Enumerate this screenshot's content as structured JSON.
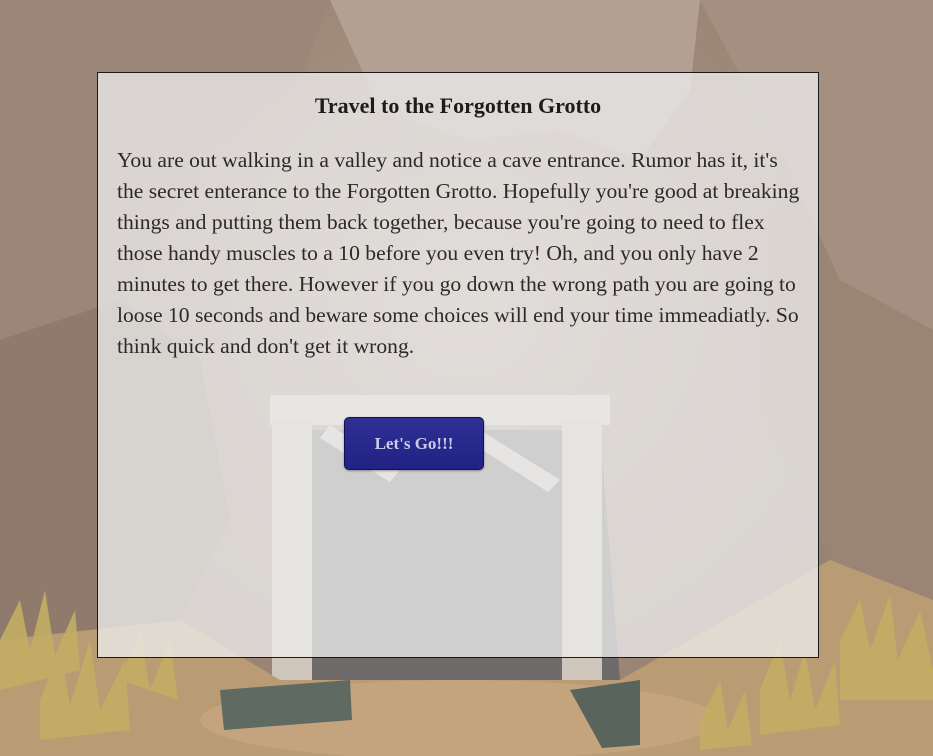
{
  "dialog": {
    "title": "Travel to the Forgotten Grotto",
    "body": "You are out walking in a valley and notice a cave entrance. Rumor has it, it's the secret enterance to the Forgotten Grotto. Hopefully you're good at breaking things and putting them back together, because you're going to need to flex those handy muscles to a 10 before you even try! Oh, and you only have 2 minutes to get there. However if you go down the wrong path you are going to loose 10 seconds and beware some choices will end your time immeadiatly. So think quick and don't get it wrong.",
    "button_label": "Let's Go!!!"
  },
  "colors": {
    "panel_background": "#ececec",
    "button": "#2a2a8c",
    "button_text": "#c9cbe8",
    "rock": "#a08a7a",
    "sand": "#c7a87e",
    "grass": "#c9b266"
  }
}
